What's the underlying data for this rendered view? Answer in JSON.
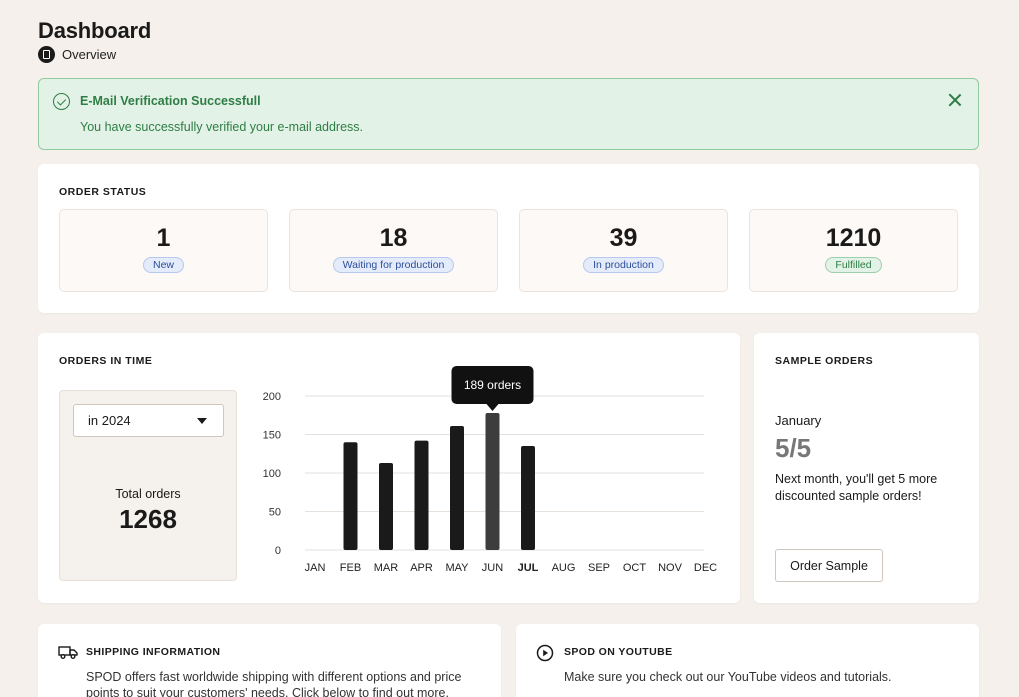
{
  "header": {
    "title": "Dashboard",
    "breadcrumb": "Overview"
  },
  "alert": {
    "title": "E-Mail Verification Successfull",
    "message": "You have successfully verified your e-mail address.",
    "color": "#2e7d45"
  },
  "order_status": {
    "heading": "ORDER STATUS",
    "items": [
      {
        "count": "1",
        "label": "New",
        "badge_color": "blue"
      },
      {
        "count": "18",
        "label": "Waiting for production",
        "badge_color": "blue"
      },
      {
        "count": "39",
        "label": "In production",
        "badge_color": "blue"
      },
      {
        "count": "1210",
        "label": "Fulfilled",
        "badge_color": "green"
      }
    ]
  },
  "orders_in_time": {
    "heading": "ORDERS IN TIME",
    "year_select": "in 2024",
    "total_label": "Total orders",
    "total_value": "1268"
  },
  "chart_data": {
    "type": "bar",
    "categories": [
      "JAN",
      "FEB",
      "MAR",
      "APR",
      "MAY",
      "JUN",
      "JUL",
      "AUG",
      "SEP",
      "OCT",
      "NOV",
      "DEC"
    ],
    "values": [
      null,
      140,
      113,
      142,
      161,
      178,
      135,
      null,
      null,
      null,
      null,
      null
    ],
    "ylim": [
      0,
      200
    ],
    "yticks": [
      0,
      50,
      100,
      150,
      200
    ],
    "highlight_index": 5,
    "current_month_index": 6,
    "tooltip": "189 orders",
    "bar_color": "#1a1a1a",
    "highlight_color": "#3d3d3d",
    "grid": true
  },
  "sample_orders": {
    "heading": "SAMPLE ORDERS",
    "month": "January",
    "count": "5/5",
    "text": "Next month, you'll get 5 more discounted sample orders!",
    "button": "Order Sample"
  },
  "shipping": {
    "heading": "SHIPPING INFORMATION",
    "text": "SPOD offers fast worldwide shipping with different options and price points to suit your customers' needs. Click below to find out more.",
    "icon": "truck-icon"
  },
  "youtube": {
    "heading": "SPOD ON YOUTUBE",
    "text": "Make sure you check out our YouTube videos and tutorials.",
    "icon": "play-icon"
  }
}
